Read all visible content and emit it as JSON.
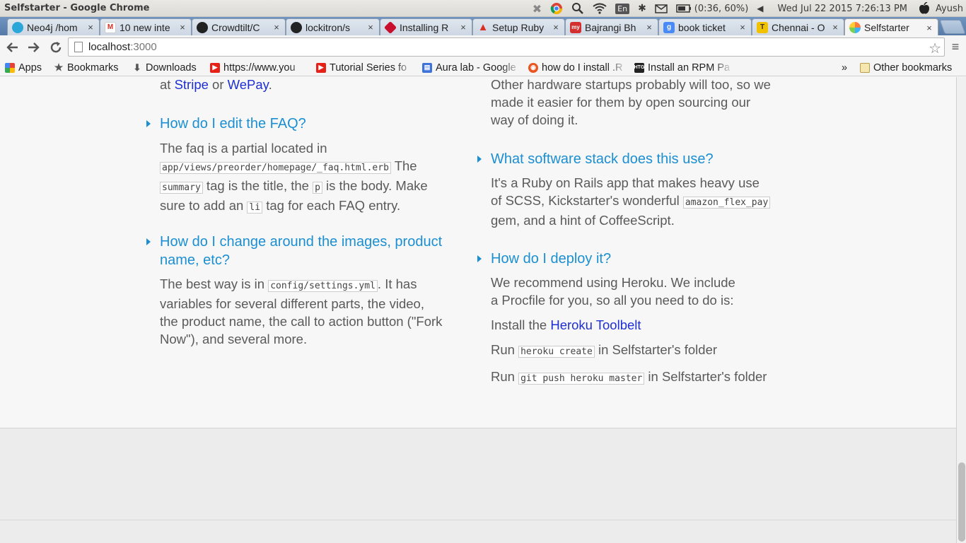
{
  "os_panel": {
    "window_title": "Selfstarter - Google Chrome",
    "battery": "(0:36, 60%)",
    "input_method": "En",
    "datetime": "Wed Jul 22 2015  7:26:13 PM",
    "user": "Ayush"
  },
  "tabs": [
    {
      "label": "Neo4j /hom",
      "icon": "neo4j-icon",
      "color": "#2aa6d8"
    },
    {
      "label": "10 new inte",
      "icon": "gmail-icon",
      "color": "#d93025"
    },
    {
      "label": "Crowdtilt/C",
      "icon": "github-icon",
      "color": "#222222"
    },
    {
      "label": "lockitron/s",
      "icon": "github-icon",
      "color": "#222222"
    },
    {
      "label": "Installing R",
      "icon": "ruby-icon",
      "color": "#c8102e"
    },
    {
      "label": "Setup Ruby",
      "icon": "gorails-icon",
      "color": "#d93025"
    },
    {
      "label": "Bajrangi Bh",
      "icon": "bookmyshow-icon",
      "color": "#d32f2f"
    },
    {
      "label": "book ticket",
      "icon": "google-search-icon",
      "color": "#4a8af4"
    },
    {
      "label": "Chennai - O",
      "icon": "tripadvisor-icon",
      "color": "#f2c200"
    },
    {
      "label": "Selfstarter",
      "icon": "selfstarter-icon",
      "color": "#ff7a3d"
    }
  ],
  "toolbar": {
    "url_host": "localhost",
    "url_port": ":3000"
  },
  "bookmarks": {
    "apps": "Apps",
    "bookmarks": "Bookmarks",
    "downloads": "Downloads",
    "youtube": "https://www.you",
    "tutorial": "Tutorial Series fo",
    "aura": "Aura lab - Google",
    "howto": "how do I install .R",
    "rpm": "Install an RPM Pa",
    "overflow": "»",
    "other": "Other bookmarks"
  },
  "faq": {
    "left_top": {
      "prefix": "at ",
      "stripe": "Stripe",
      "or": " or ",
      "wepay": "WePay",
      "period": "."
    },
    "edit_faq": {
      "question": "How do I edit the FAQ?",
      "a1": "The faq is a partial located in",
      "code1": "app/views/preorder/homepage/_faq.html.erb",
      "a2": " The ",
      "code2": "summary",
      "a3": " tag is the title, the ",
      "code3": "p",
      "a4": " is the body. Make sure to add an ",
      "code4": "li",
      "a5": " tag for each FAQ entry."
    },
    "change_images": {
      "question": "How do I change around the images, product name, etc?",
      "a1": "The best way is in ",
      "code1": "config/settings.yml",
      "a2": ". It has variables for several different parts, the video, the product name, the call to action button (\"Fork Now\"), and several more."
    },
    "right_top": {
      "text": "Other hardware startups probably will too, so we made it easier for them by open sourcing our way of doing it."
    },
    "software_stack": {
      "question": "What software stack does this use?",
      "a1": "It's a Ruby on Rails app that makes heavy use of SCSS, Kickstarter's wonderful ",
      "code1": "amazon_flex_pay",
      "a2": " gem, and a hint of CoffeeScript."
    },
    "deploy": {
      "question": "How do I deploy it?",
      "intro": "We recommend using Heroku. We include a Procfile for you, so all you need to do is:",
      "step1_prefix": "Install the ",
      "step1_link": "Heroku Toolbelt",
      "step2_prefix": "Run ",
      "step2_code": "heroku create",
      "step2_suffix": " in Selfstarter's folder",
      "step3_prefix": "Run ",
      "step3_code": "git push heroku master",
      "step3_suffix": " in Selfstarter's folder"
    }
  }
}
